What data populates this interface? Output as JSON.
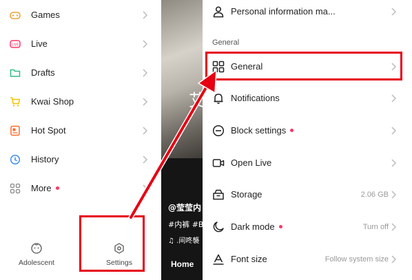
{
  "left_menu": {
    "items": [
      {
        "label": "Games",
        "icon": "gamepad-icon",
        "color": "#f0a23a"
      },
      {
        "label": "Live",
        "icon": "live-tv-icon",
        "color": "#fe3666"
      },
      {
        "label": "Drafts",
        "icon": "folder-icon",
        "color": "#2ebd85"
      },
      {
        "label": "Kwai Shop",
        "icon": "shopping-cart-icon",
        "color": "#f5c400"
      },
      {
        "label": "Hot Spot",
        "icon": "hot-spot-icon",
        "color": "#ff6b2c"
      },
      {
        "label": "History",
        "icon": "clock-icon",
        "color": "#3b8cf5"
      },
      {
        "label": "More",
        "icon": "grid-icon",
        "color": "#888888"
      }
    ],
    "bottom": {
      "adolescent_label": "Adolescent",
      "settings_label": "Settings"
    }
  },
  "video": {
    "overlay_char": "艾",
    "user_handle": "@莹莹内",
    "hashtags": "#内裤 #B",
    "music": "♫ .间咚襲",
    "home_tab": "Home"
  },
  "settings": {
    "top_item": {
      "label": "Personal information ma...",
      "icon": "person-icon"
    },
    "section_label": "General",
    "items": [
      {
        "label": "General",
        "icon": "grid-icon",
        "value": ""
      },
      {
        "label": "Notifications",
        "icon": "bell-icon",
        "value": ""
      },
      {
        "label": "Block settings",
        "icon": "block-icon",
        "value": ""
      },
      {
        "label": "Open Live",
        "icon": "video-camera-icon",
        "value": ""
      },
      {
        "label": "Storage",
        "icon": "storage-box-icon",
        "value": "2.06 GB"
      },
      {
        "label": "Dark mode",
        "icon": "moon-icon",
        "value": "Turn off"
      },
      {
        "label": "Font size",
        "icon": "font-size-icon",
        "value": "Follow system size"
      }
    ]
  },
  "colors": {
    "accent_red": "#e60012",
    "notification_dot": "#fe3666"
  }
}
